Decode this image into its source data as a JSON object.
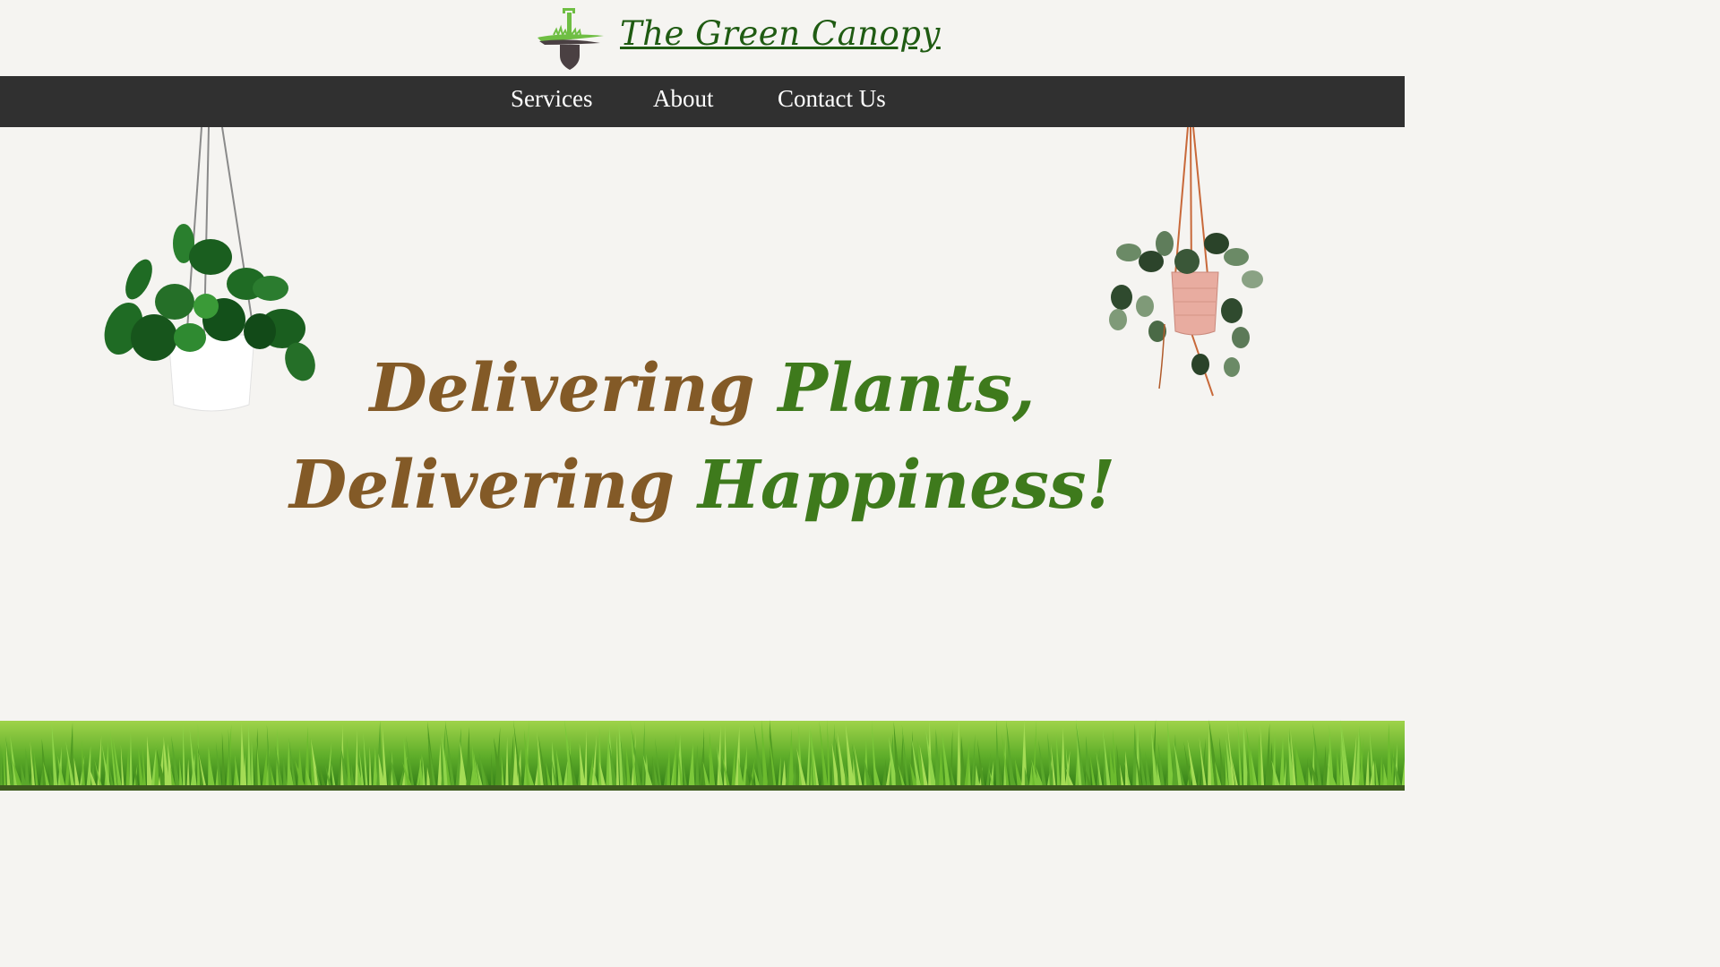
{
  "brand": {
    "name": "The Green Canopy",
    "logo_icon": "shovel-grass-icon",
    "color": "#1f5b12"
  },
  "nav": {
    "items": [
      {
        "label": "Services"
      },
      {
        "label": "About"
      },
      {
        "label": "Contact Us"
      }
    ],
    "background": "#303030"
  },
  "hero": {
    "line1": {
      "brown": "Delivering",
      "green": "Plants,"
    },
    "line2": {
      "brown": "Delivering",
      "green": "Happiness!"
    },
    "colors": {
      "brown": "#835a27",
      "green": "#3e7a1c"
    }
  },
  "decor": {
    "left_plant_icon": "hanging-plant-white-pot-icon",
    "right_plant_icon": "hanging-plant-pink-pot-icon",
    "ground_icon": "grass-icon"
  }
}
